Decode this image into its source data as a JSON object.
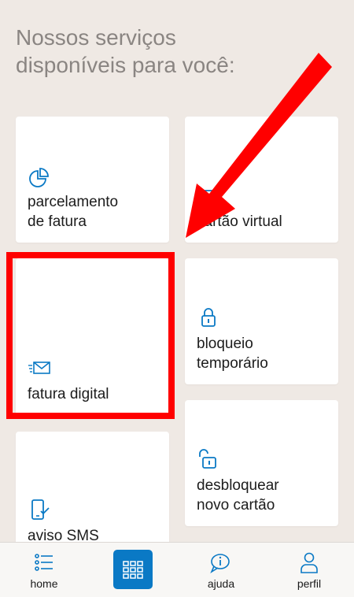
{
  "header": {
    "title": "Nossos serviços\ndisponíveis para você:"
  },
  "services": {
    "parcelamento": {
      "label": "parcelamento\nde fatura",
      "icon": "pie-chart-icon"
    },
    "cartao_virtual": {
      "label": "cartão virtual",
      "icon": "card-icon"
    },
    "fatura_digital": {
      "label": "fatura digital",
      "icon": "email-envelope-icon"
    },
    "bloqueio": {
      "label": "bloqueio\ntemporário",
      "icon": "lock-icon"
    },
    "aviso_sms": {
      "label": "aviso SMS",
      "icon": "phone-check-icon"
    },
    "desbloquear": {
      "label": "desbloquear\nnovo cartão",
      "icon": "unlock-icon"
    }
  },
  "bottom_nav": {
    "home": {
      "label": "home",
      "icon": "list-icon"
    },
    "center": {
      "icon": "grid-menu-icon"
    },
    "ajuda": {
      "label": "ajuda",
      "icon": "help-chat-icon"
    },
    "perfil": {
      "label": "perfil",
      "icon": "person-icon"
    }
  },
  "colors": {
    "background": "#efe9e4",
    "accent": "#0a79c5",
    "annotation": "#ff0000"
  }
}
